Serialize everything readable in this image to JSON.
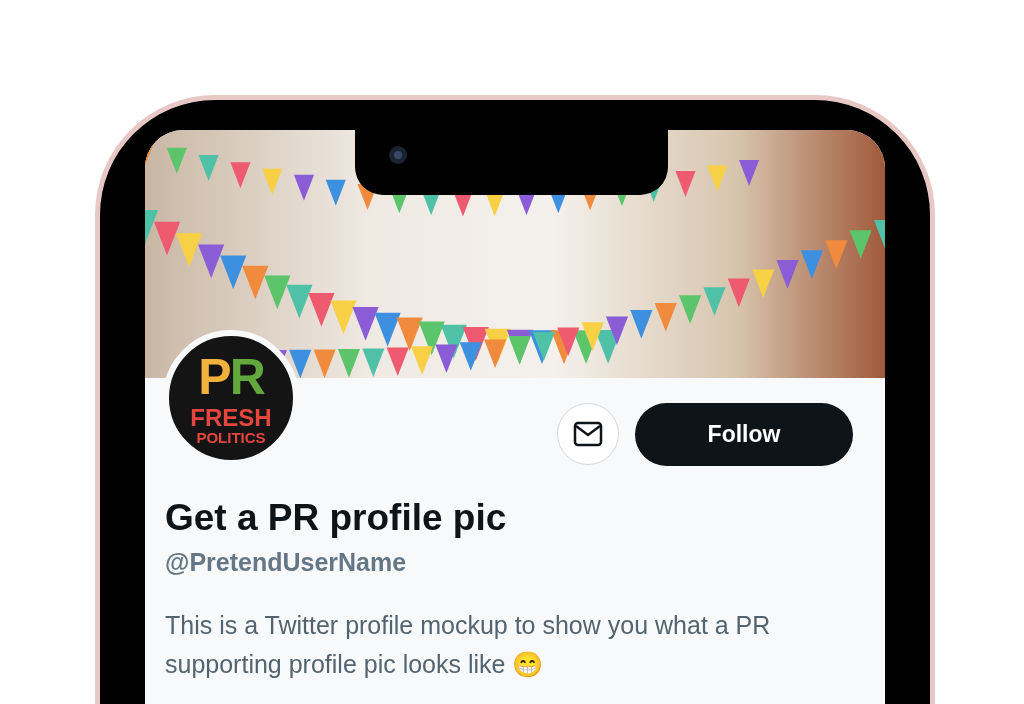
{
  "profile": {
    "avatar_logo": {
      "letters": [
        {
          "text": "P",
          "color": "#f0b23a"
        },
        {
          "text": "R",
          "color": "#62a83c"
        }
      ],
      "line_1": "FRESH",
      "line_2": "POLITICS"
    },
    "follow_button": "Follow",
    "display_name": "Get a PR profile pic",
    "handle": "@PretendUserName",
    "bio": "This is a Twitter profile mockup to show you what a PR supporting profile pic looks like 😁"
  }
}
